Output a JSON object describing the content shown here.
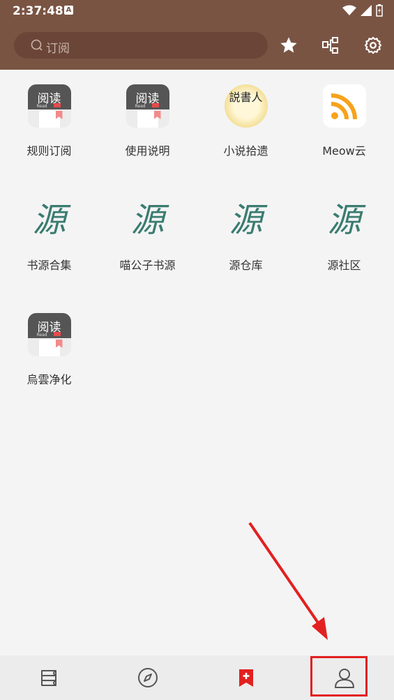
{
  "status_bar": {
    "time": "2:37:48",
    "notification_letter": "A"
  },
  "search": {
    "placeholder": "订阅"
  },
  "toolbar": {
    "icons": [
      "star-icon",
      "group-icon",
      "settings-icon"
    ]
  },
  "subscriptions": [
    {
      "label": "规则订阅",
      "icon": "yuedu-app-icon",
      "icon_title": "阅读",
      "icon_sub": "Read"
    },
    {
      "label": "使用说明",
      "icon": "yuedu-app-icon",
      "icon_title": "阅读",
      "icon_sub": "Read"
    },
    {
      "label": "小说拾遗",
      "icon": "shuoshuren-icon",
      "icon_title": "説書人"
    },
    {
      "label": "Meow云",
      "icon": "rss-icon"
    },
    {
      "label": "书源合集",
      "icon": "yuan-icon",
      "icon_title": "源"
    },
    {
      "label": "喵公子书源",
      "icon": "yuan-icon",
      "icon_title": "源"
    },
    {
      "label": "源仓库",
      "icon": "yuan-icon",
      "icon_title": "源"
    },
    {
      "label": "源社区",
      "icon": "yuan-icon",
      "icon_title": "源"
    },
    {
      "label": "烏雲净化",
      "icon": "yuedu-app-icon",
      "icon_title": "阅读",
      "icon_sub": "Read"
    }
  ],
  "bottom_nav": [
    {
      "name": "bookshelf-icon"
    },
    {
      "name": "discover-icon"
    },
    {
      "name": "rss-bookmark-icon"
    },
    {
      "name": "profile-icon"
    }
  ],
  "colors": {
    "topbar": "#7a5443",
    "accent": "#e32020",
    "yuan_green": "#3a7c70"
  }
}
